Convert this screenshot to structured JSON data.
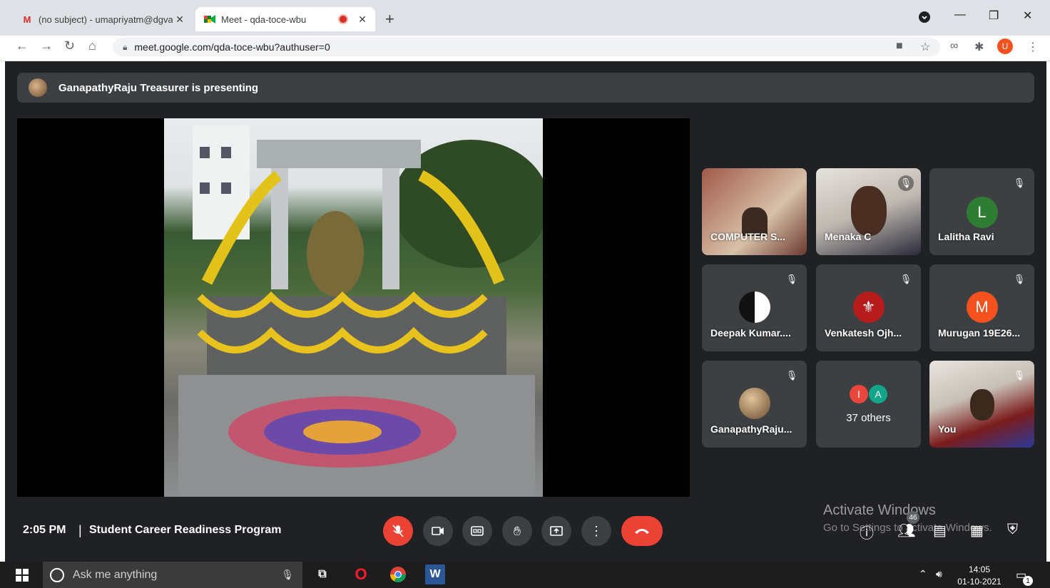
{
  "browser": {
    "tabs": [
      {
        "title": "(no subject) - umapriyatm@dgva",
        "favicon": "gmail-icon"
      },
      {
        "title": "Meet - qda-toce-wbu",
        "favicon": "meet-icon",
        "recording": true
      }
    ],
    "new_tab": "+",
    "url": "meet.google.com/qda-toce-wbu?authuser=0",
    "profile_initial": "U"
  },
  "meet": {
    "presenting_banner": "GanapathyRaju Treasurer is presenting",
    "participants": [
      {
        "name": "COMPUTER S...",
        "type": "video"
      },
      {
        "name": "Menaka C",
        "type": "video",
        "muted": true
      },
      {
        "name": "Lalitha Ravi",
        "initial": "L",
        "color": "#2e7d32",
        "muted": true
      },
      {
        "name": "Deepak Kumar....",
        "type": "avatar",
        "muted": true
      },
      {
        "name": "Venkatesh Ojh...",
        "type": "avatar",
        "muted": true
      },
      {
        "name": "Murugan 19E26...",
        "initial": "M",
        "color": "#f4511e",
        "muted": true
      },
      {
        "name": "GanapathyRaju...",
        "type": "avatar",
        "muted": true
      },
      {
        "name": "You",
        "type": "video",
        "muted": true
      }
    ],
    "others": {
      "label": "37 others",
      "initials": [
        "I",
        "A"
      ],
      "colors": [
        "#e8453c",
        "#12a589"
      ]
    },
    "time": "2:05 PM",
    "separator": "|",
    "meeting_title": "Student Career Readiness Program",
    "participant_count": "46",
    "activate_line1": "Activate Windows",
    "activate_line2": "Go to Settings to activate Windows."
  },
  "taskbar": {
    "search_placeholder": "Ask me anything",
    "time": "14:05",
    "date": "01-10-2021",
    "notification_count": "1"
  },
  "colors": {
    "meet_bg": "#202124",
    "tile_bg": "#3c4043",
    "end_call": "#ea4335"
  }
}
